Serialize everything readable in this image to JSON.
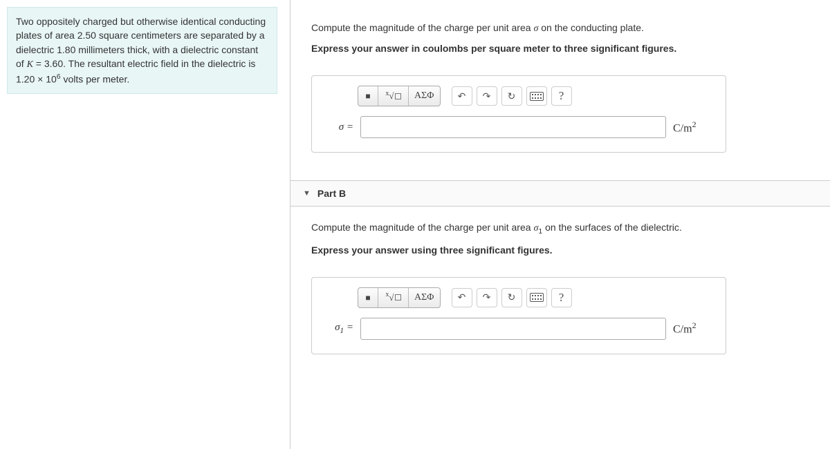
{
  "problem": {
    "text_html": "Two oppositely charged but otherwise identical conducting plates of area 2.50 square centimeters are separated by a dielectric 1.80 millimeters thick, with a dielectric constant of <em class='serif-it'>K</em> = 3.60. The resultant electric field in the dielectric is 1.20 × 10<sup>6</sup> volts per meter."
  },
  "partA": {
    "prompt_html": "Compute the magnitude of the charge per unit area <em class='serif-it'>σ</em> on the conducting plate.",
    "instruction": "Express your answer in coulombs per square meter to three significant figures.",
    "var_label_html": "<em>σ</em> =",
    "value": "",
    "unit_html": "C/m<sup>2</sup>"
  },
  "partB": {
    "header": "Part B",
    "prompt_html": "Compute the magnitude of the charge per unit area <em class='serif-it'>σ</em><sub>1</sub> on the surfaces of the dielectric.",
    "instruction": "Express your answer using three significant figures.",
    "var_label_html": "<em>σ</em><sub>1</sub> =",
    "value": "",
    "unit_html": "C/m<sup>2</sup>"
  },
  "toolbar": {
    "template": "■",
    "math": "x√□",
    "greek": "ΑΣΦ",
    "undo": "↶",
    "redo": "↷",
    "reset": "↻",
    "help": "?"
  }
}
